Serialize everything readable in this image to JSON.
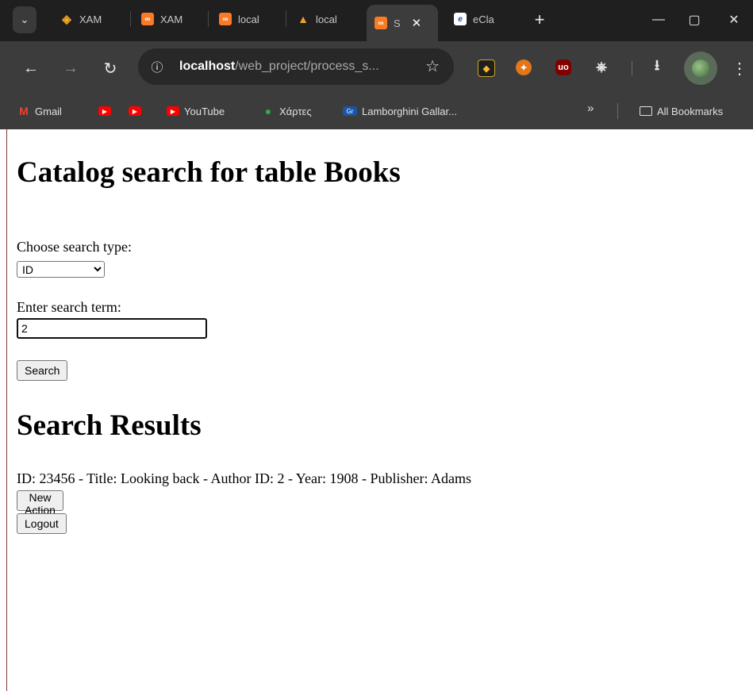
{
  "browser": {
    "tabs": [
      {
        "label": "XAM",
        "icon": "xampp-diamond-icon",
        "color": "#f5a623"
      },
      {
        "label": "XAM",
        "icon": "xampp-icon",
        "color": "#fb7a24"
      },
      {
        "label": "local",
        "icon": "xampp-icon",
        "color": "#fb7a24"
      },
      {
        "label": "local",
        "icon": "phpmyadmin-icon",
        "color": "#f0a030"
      },
      {
        "label": "S",
        "icon": "xampp-icon",
        "color": "#fb7a24",
        "active": true
      },
      {
        "label": "eCla",
        "icon": "eclass-icon",
        "color": "#ffffff"
      }
    ],
    "url_host": "localhost",
    "url_path": "/web_project/process_s...",
    "bookmarks": [
      {
        "label": "Gmail",
        "icon": "gmail-icon"
      },
      {
        "label": "",
        "icon": "youtube-icon"
      },
      {
        "label": "",
        "icon": "youtube-icon"
      },
      {
        "label": "YouTube",
        "icon": "youtube-icon"
      },
      {
        "label": "Χάρτες",
        "icon": "maps-pin-icon"
      },
      {
        "label": "Lamborghini Gallar...",
        "icon": "car-site-icon"
      }
    ],
    "all_bookmarks_label": "All Bookmarks"
  },
  "page": {
    "title": "Catalog search for table Books",
    "search_type_label": "Choose search type:",
    "search_type_selected": "ID",
    "search_term_label": "Enter search term:",
    "search_term_value": "2",
    "search_button": "Search",
    "results_heading": "Search Results",
    "result_line": "ID: 23456 - Title: Looking back - Author ID: 2 - Year: 1908 - Publisher: Adams",
    "new_action_button": "New Action",
    "logout_button": "Logout"
  }
}
